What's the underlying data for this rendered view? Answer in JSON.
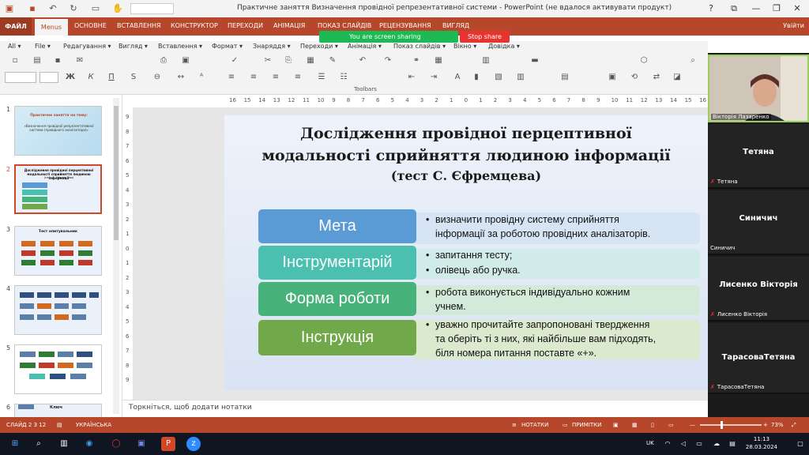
{
  "window": {
    "title": "Практичне заняття Визначення провідної репрезентативної системи - PowerPoint (не вдалося активувати продукт)",
    "controls": [
      "?",
      "⧉",
      "—",
      "❐",
      "✕"
    ]
  },
  "ribbon_tabs": {
    "file": "ФАЙЛ",
    "menus": "Menus",
    "items": [
      "ОСНОВНЕ",
      "ВСТАВЛЕННЯ",
      "КОНСТРУКТОР",
      "ПЕРЕХОДИ",
      "АНІМАЦІЯ",
      "ПОКАЗ СЛАЙДІВ",
      "РЕЦЕНЗУВАННЯ",
      "ВИГЛЯД"
    ],
    "user": "Увійти"
  },
  "screen_share": {
    "status": "You are screen sharing",
    "stop_label": "Stop share"
  },
  "menu_bar": [
    "All ▾",
    "File ▾",
    "Редагування ▾",
    "Вигляд ▾",
    "Вставлення ▾",
    "Формат ▾",
    "Знаряддя ▾",
    "Переходи ▾",
    "Анімація ▾",
    "Показ слайдів ▾",
    "Вікно ▾",
    "Довідка ▾"
  ],
  "toolbars_label": "Toolbars",
  "format_buttons": [
    "Ж",
    "К",
    "П",
    "S"
  ],
  "ruler": {
    "horizontal": [
      "16",
      "15",
      "14",
      "13",
      "12",
      "11",
      "10",
      "9",
      "8",
      "7",
      "6",
      "5",
      "4",
      "3",
      "2",
      "1",
      "0",
      "1",
      "2",
      "3",
      "4",
      "5",
      "6",
      "7",
      "8",
      "9",
      "10",
      "11",
      "12",
      "13",
      "14",
      "15",
      "16"
    ],
    "vertical": [
      "9",
      "8",
      "7",
      "6",
      "5",
      "4",
      "3",
      "2",
      "1",
      "0",
      "1",
      "2",
      "3",
      "4",
      "5",
      "6",
      "7",
      "8",
      "9"
    ]
  },
  "thumbnails": [
    {
      "num": "1",
      "title": "Практичне заняття на тему:",
      "subtitle": "«Визначення провідної репрезентативної системи (провідного аналізатора)»"
    },
    {
      "num": "2",
      "title": "Дослідження провідної перцептивної модальності сприйняття людиною інформації",
      "subtitle": "(тест С. Єфремцева)"
    },
    {
      "num": "3",
      "title": "Тест опитувальник"
    },
    {
      "num": "4"
    },
    {
      "num": "5"
    },
    {
      "num": "6",
      "title": "Ключ"
    }
  ],
  "slide": {
    "title_line1": "Дослідження провідної перцептивної",
    "title_line2": "модальності сприйняття людиною інформації",
    "subtitle": "(тест С. Єфремцева)",
    "rows": [
      {
        "label": "Мета",
        "color": "#5b9bd5",
        "band": "#d7e4f3",
        "bullets": [
          [
            "визначити провідну систему сприйняття",
            "інформації за роботою провідних аналізаторів."
          ]
        ]
      },
      {
        "label": "Інструментарій",
        "color": "#4bbfb0",
        "band": "#d1ece8",
        "bullets": [
          [
            "запитання тесту;"
          ],
          [
            "олівець або ручка."
          ]
        ]
      },
      {
        "label": "Форма роботи",
        "color": "#47b37a",
        "band": "#d3ead9",
        "bullets": [
          [
            "робота виконується індивідуально кожним",
            "учнем."
          ]
        ]
      },
      {
        "label": "Інструкція",
        "color": "#71a84a",
        "band": "#dbe9cf",
        "bullets": [
          [
            "уважно прочитайте запропоновані твердження",
            "та оберіть ті з них, які найбільше вам підходять,",
            "біля номера питання поставте «+»."
          ]
        ]
      }
    ]
  },
  "notes_placeholder": "Торкніться, щоб додати нотатки",
  "participants": [
    {
      "name": "Вікторія Лазаренко",
      "video": true
    },
    {
      "big": "Тетяна",
      "small": "Тетяна",
      "muted": true
    },
    {
      "big": "Синичич",
      "small": "Синичич",
      "muted": false
    },
    {
      "big": "Лисенко Вікторія",
      "small": "Лисенко Вікторія",
      "muted": true
    },
    {
      "big": "ТарасоваТетяна",
      "small": "ТарасоваТетяна",
      "muted": true
    }
  ],
  "status_bar": {
    "slide": "СЛАЙД 2 З 12",
    "language": "УКРАЇНСЬКА",
    "notes": "НОТАТКИ",
    "comments": "ПРИМІТКИ",
    "zoom": "73%"
  },
  "taskbar": {
    "lang": "UK",
    "time": "11:13",
    "date": "28.03.2024"
  }
}
